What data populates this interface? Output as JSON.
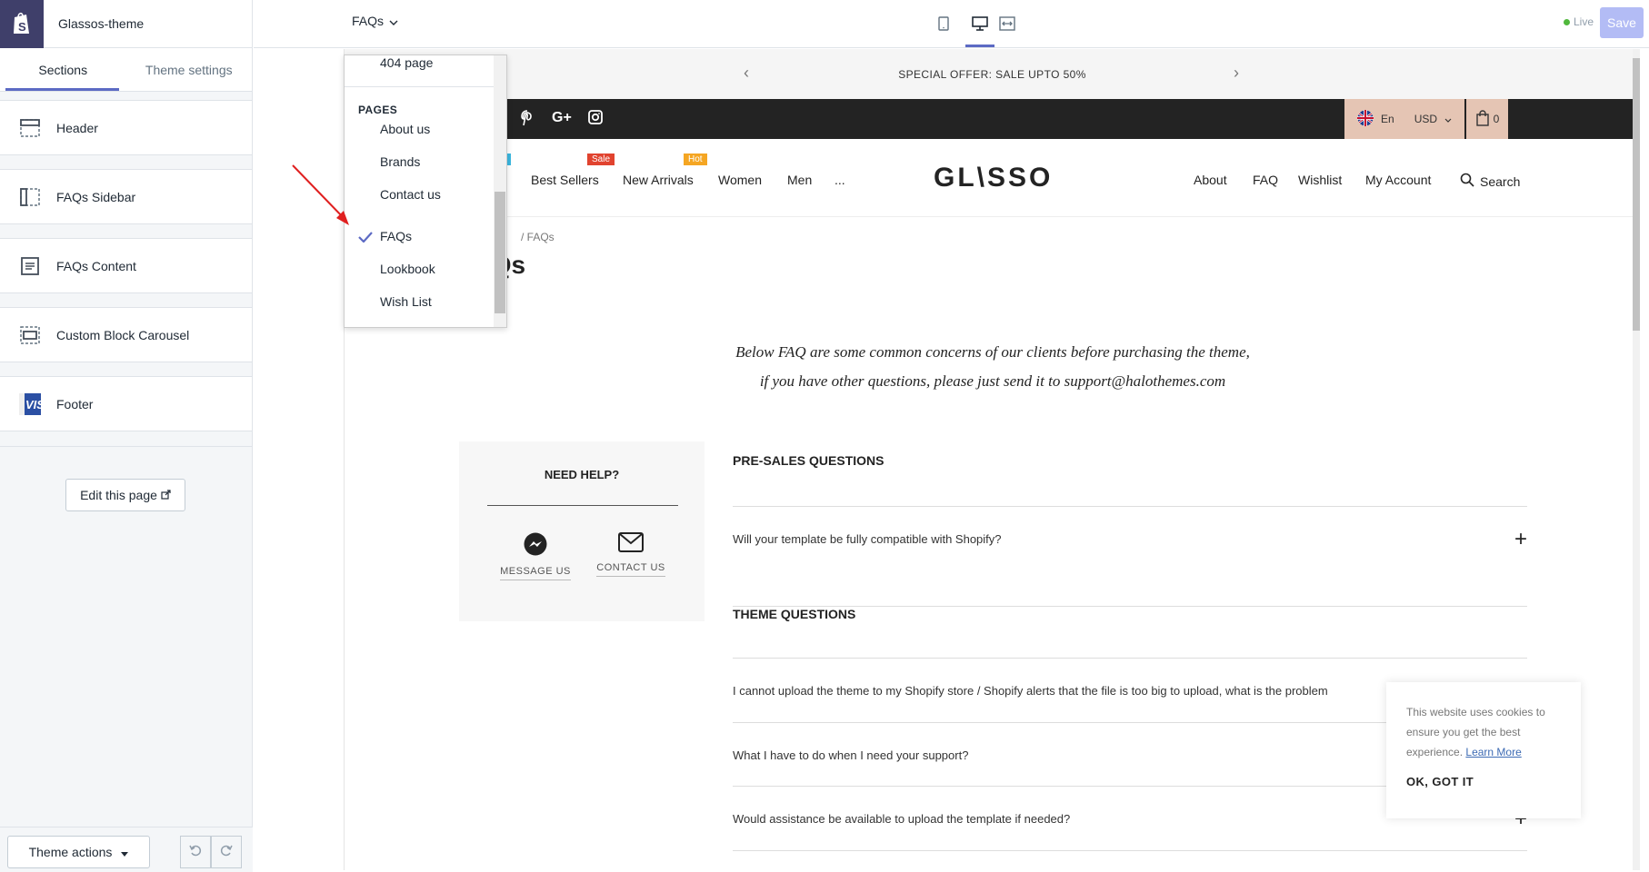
{
  "app": {
    "theme_name": "Glassos-theme",
    "colors": {
      "accent": "#5c6ac4",
      "logo_bg": "#3f3f6a",
      "save_disabled": "#b3bcf5",
      "live": "#50b83c"
    }
  },
  "sidebar": {
    "tabs": [
      {
        "label": "Sections",
        "active": true
      },
      {
        "label": "Theme settings",
        "active": false
      }
    ],
    "sections": [
      {
        "label": "Header",
        "icon": "header-layout-icon"
      },
      {
        "label": "FAQs Sidebar",
        "icon": "sidebar-layout-icon"
      },
      {
        "label": "FAQs Content",
        "icon": "text-layout-icon"
      },
      {
        "label": "Custom Block Carousel",
        "icon": "carousel-layout-icon"
      },
      {
        "label": "Footer",
        "icon": "footer-thumbnail-icon"
      }
    ],
    "edit_page_label": "Edit this page",
    "theme_actions_label": "Theme actions"
  },
  "topbar": {
    "current_page": "FAQs",
    "devices": [
      "mobile-icon",
      "desktop-icon",
      "fullwidth-icon"
    ],
    "active_device": "desktop-icon",
    "status": "Live",
    "save_label": "Save"
  },
  "dropdown": {
    "top_item": "404 page",
    "group_label": "PAGES",
    "items": [
      "About us",
      "Brands",
      "Contact us",
      "FAQs",
      "Lookbook",
      "Wish List"
    ],
    "selected": "FAQs"
  },
  "preview": {
    "announcement": "SPECIAL OFFER: SALE UPTO 50%",
    "social_icons": [
      "pinterest-icon",
      "google-plus-icon",
      "instagram-icon"
    ],
    "language": "En",
    "currency": "USD",
    "cart_count": "0",
    "nav_left": [
      "Best Sellers",
      "New Arrivals",
      "Women",
      "Men",
      "..."
    ],
    "badges": {
      "partial": "w",
      "sale": "Sale",
      "hot": "Hot"
    },
    "badge_colors": {
      "new": "#3ab7e0",
      "sale": "#e1432f",
      "hot": "#f5a623"
    },
    "logo": "GL\\SSO",
    "nav_right": [
      "About",
      "FAQ",
      "Wishlist",
      "My Account"
    ],
    "search_label": "Search",
    "breadcrumb": "/ FAQs",
    "page_title": "FAQs",
    "intro_line1": "Below FAQ are some common concerns of our clients before purchasing the theme,",
    "intro_line2": "if you have other questions, please just send it to support@halothemes.com",
    "help": {
      "title": "NEED HELP?",
      "message_label": "MESSAGE US",
      "contact_label": "CONTACT US"
    },
    "faq_groups": [
      {
        "title": "PRE-SALES QUESTIONS",
        "questions": [
          "Will your template be fully compatible with Shopify?"
        ]
      },
      {
        "title": "THEME QUESTIONS",
        "questions": [
          "I cannot upload the theme to my Shopify store / Shopify alerts that the file is too big to upload, what is the problem",
          "What I have to do when I need your support?",
          "Would assistance be available to upload the template if needed?"
        ]
      }
    ],
    "cookie": {
      "text": "This website uses cookies to ensure you get the best experience.",
      "link": "Learn More",
      "button": "OK, GOT IT"
    }
  }
}
